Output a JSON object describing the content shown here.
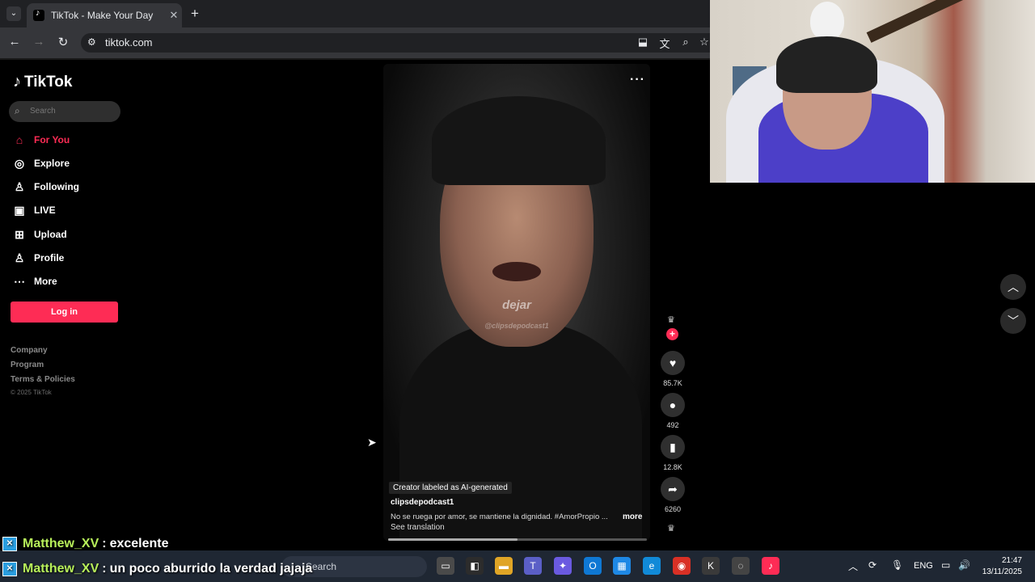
{
  "browser": {
    "tab_title": "TikTok - Make Your Day",
    "url": "tiktok.com",
    "icons": [
      "tab-menu-icon",
      "close-icon",
      "new-tab-icon",
      "back-icon",
      "forward-icon",
      "reload-icon",
      "site-settings-icon",
      "install-icon",
      "translate-icon",
      "zoom-icon",
      "bookmark-star-icon"
    ]
  },
  "sidebar": {
    "logo": "TikTok",
    "search_placeholder": "Search",
    "items": [
      {
        "label": "For You",
        "icon": "home-icon"
      },
      {
        "label": "Explore",
        "icon": "compass-icon"
      },
      {
        "label": "Following",
        "icon": "following-icon"
      },
      {
        "label": "LIVE",
        "icon": "live-icon"
      },
      {
        "label": "Upload",
        "icon": "upload-icon"
      },
      {
        "label": "Profile",
        "icon": "profile-icon"
      },
      {
        "label": "More",
        "icon": "more-icon"
      }
    ],
    "login_label": "Log in",
    "footer": [
      "Company",
      "Program",
      "Terms & Policies"
    ],
    "copyright": "© 2025 TikTok"
  },
  "video": {
    "caption_main": "dejar",
    "caption_handle": "@clipsdepodcast1",
    "ai_label": "Creator labeled as AI-generated",
    "author": "clipsdepodcast1",
    "description": "No se ruega por amor, se mantiene la dignidad. #AmorPropio ...",
    "more_label": "more",
    "see_translation": "See translation",
    "progress": 0.5
  },
  "actions": {
    "likes": "85.7K",
    "comments": "492",
    "saves": "12.8K",
    "shares": "6260"
  },
  "chat": [
    {
      "user": "Matthew_XV",
      "message": "excelente"
    },
    {
      "user": "Matthew_XV",
      "message": "un poco aburrido la verdad jajaja"
    }
  ],
  "taskbar": {
    "search_label": "Search",
    "language": "ENG",
    "time": "21:47",
    "date": "13/11/2025"
  },
  "colors": {
    "accent": "#fe2c55",
    "chat_user": "#b8f05a"
  }
}
